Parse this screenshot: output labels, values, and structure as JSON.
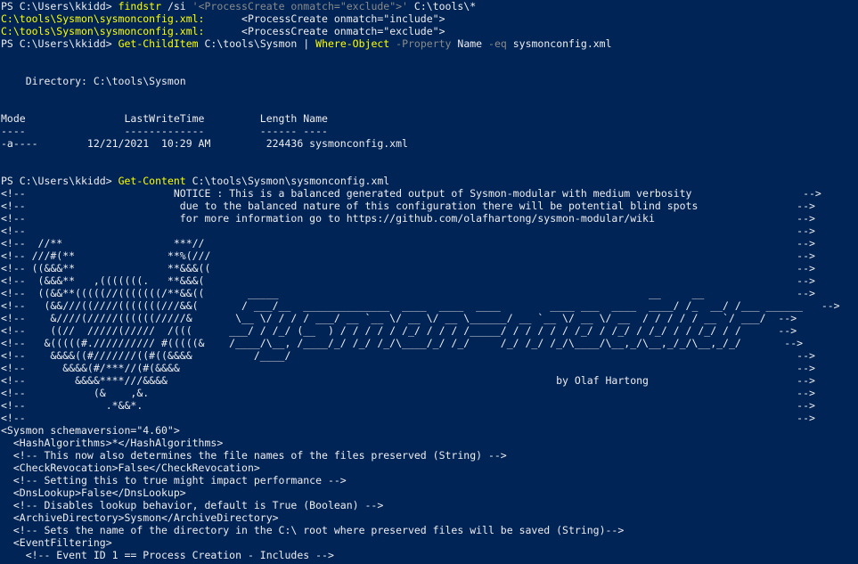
{
  "colors": {
    "background": "#012456",
    "text": "#eeedf0",
    "command": "#ffff00",
    "parameter_string": "#8a8a8a",
    "match_file": "#ffff00"
  },
  "cmd1": {
    "prompt": "PS C:\\Users\\kkidd> ",
    "command": "findstr",
    "args_a": " /si ",
    "pattern": "'<ProcessCreate onmatch=\"exclude\">'",
    "args_b": " C:\\tools\\*"
  },
  "findstr_results": [
    {
      "file": "C:\\tools\\Sysmon\\sysmonconfig.xml:",
      "text": "      <ProcessCreate onmatch=\"include\">"
    },
    {
      "file": "C:\\tools\\Sysmon\\sysmonconfig.xml:",
      "text": "      <ProcessCreate onmatch=\"exclude\">"
    }
  ],
  "cmd2": {
    "prompt": "PS C:\\Users\\kkidd> ",
    "command": "Get-ChildItem",
    "path": " C:\\tools\\Sysmon | ",
    "filter_cmd": "Where-Object",
    "param1": " -Property",
    "name": " Name ",
    "param2": "-eq",
    "value": " sysmonconfig.xml"
  },
  "dir_listing": {
    "directory_line": "    Directory: C:\\tools\\Sysmon",
    "header": "Mode                LastWriteTime         Length Name",
    "separator": "----                -------------         ------ ----",
    "row": "-a----        12/21/2021  10:29 AM         224436 sysmonconfig.xml"
  },
  "cmd3": {
    "prompt": "PS C:\\Users\\kkidd> ",
    "command": "Get-Content",
    "args": " C:\\tools\\Sysmon\\sysmonconfig.xml"
  },
  "content_lines": [
    "<!--                        NOTICE : This is a balanced generated output of Sysmon-modular with medium verbosity                  -->",
    "<!--                         due to the balanced nature of this configuration there will be potential blind spots                -->",
    "<!--                         for more information go to https://github.com/olafhartong/sysmon-modular/wiki                       -->",
    "<!--                                                                                                                             -->",
    "<!--  //**                  ***//                                                                                                -->",
    "<!-- ///#(**               **%(///                                                                                               -->",
    "<!-- ((&&&**               **&&&((                                                                                               -->",
    "<!--  (&&&**   ,(((((((.   **&&&(                                                                                                -->",
    "<!--  ((&&**(((((//(((((((/**&&((       _____                                                            __     __               -->",
    "<!--   (&&///((////(((((((///&&(       / ___/__  ______________  ____  ____  ____        ____ ___  ____  ____/ /_  __/ /___ ______   -->",
    "<!--    &////(/////((((((/////&       \\__ \\/ / / / ___/ __ `__ \\/ __ \\/ __ \\______/ __ `__ \\/ __ \\/ __  / / / / / __ `/ ___/  -->",
    "<!--    ((//  /////(/////  /(((      ___/ / /_/ (__  ) / / / / / /_/ / / / /_____/ / / / / / /_/ / /_/ / /_/ / / /_/ / /      -->",
    "<!--   &(((((#.////////// #(((((&    /____/\\__, /____/_/ /_/ /_/\\____/_/ /_/     /_/ /_/ /_/\\____/\\__,_/\\__,_/_/\\__,_/_/       -->",
    "<!--    &&&&((#///////((#((&&&&          /____/                                                                                  -->",
    "<!--      &&&&(#/***//(#(&&&&                                                                                                    -->",
    "<!--        &&&&****///&&&&                                                               by Olaf Hartong                        -->",
    "<!--           (&    ,&.                                                                                                         -->",
    "<!--             .*&&*.                                                                                                          -->",
    "<!--                                                                                                                             -->",
    "<Sysmon schemaversion=\"4.60\">",
    "  <HashAlgorithms>*</HashAlgorithms>",
    "  <!-- This now also determines the file names of the files preserved (String) -->",
    "  <CheckRevocation>False</CheckRevocation>",
    "  <!-- Setting this to true might impact performance -->",
    "  <DnsLookup>False</DnsLookup>",
    "  <!-- Disables lookup behavior, default is True (Boolean) -->",
    "  <ArchiveDirectory>Sysmon</ArchiveDirectory>",
    "  <!-- Sets the name of the directory in the C:\\ root where preserved files will be saved (String)-->",
    "  <EventFiltering>",
    "    <!-- Event ID 1 == Process Creation - Includes -->"
  ]
}
